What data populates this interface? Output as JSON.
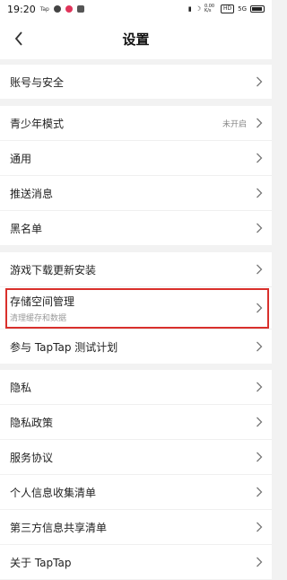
{
  "status_bar": {
    "time": "19:20",
    "tap_label": "Tap",
    "net_speed": "0.00 K/s",
    "network": "HD",
    "signal": "5G"
  },
  "nav": {
    "title": "设置",
    "back_icon": "chevron-left-icon"
  },
  "sections": {
    "account": {
      "label": "账号与安全"
    },
    "youth": {
      "label": "青少年模式",
      "status": "未开启"
    },
    "general": {
      "label": "通用"
    },
    "push": {
      "label": "推送消息"
    },
    "blacklist": {
      "label": "黑名单"
    },
    "game_update": {
      "label": "游戏下载更新安装"
    },
    "storage": {
      "label": "存储空间管理",
      "sublabel": "清理缓存和数据"
    },
    "test_plan": {
      "label": "参与 TapTap 测试计划"
    },
    "privacy": {
      "label": "隐私"
    },
    "privacy_policy": {
      "label": "隐私政策"
    },
    "service": {
      "label": "服务协议"
    },
    "personal_info": {
      "label": "个人信息收集清单"
    },
    "third_party": {
      "label": "第三方信息共享清单"
    },
    "about": {
      "label": "关于 TapTap"
    }
  },
  "colors": {
    "highlight": "#d9302c",
    "background": "#f2f2f2"
  }
}
